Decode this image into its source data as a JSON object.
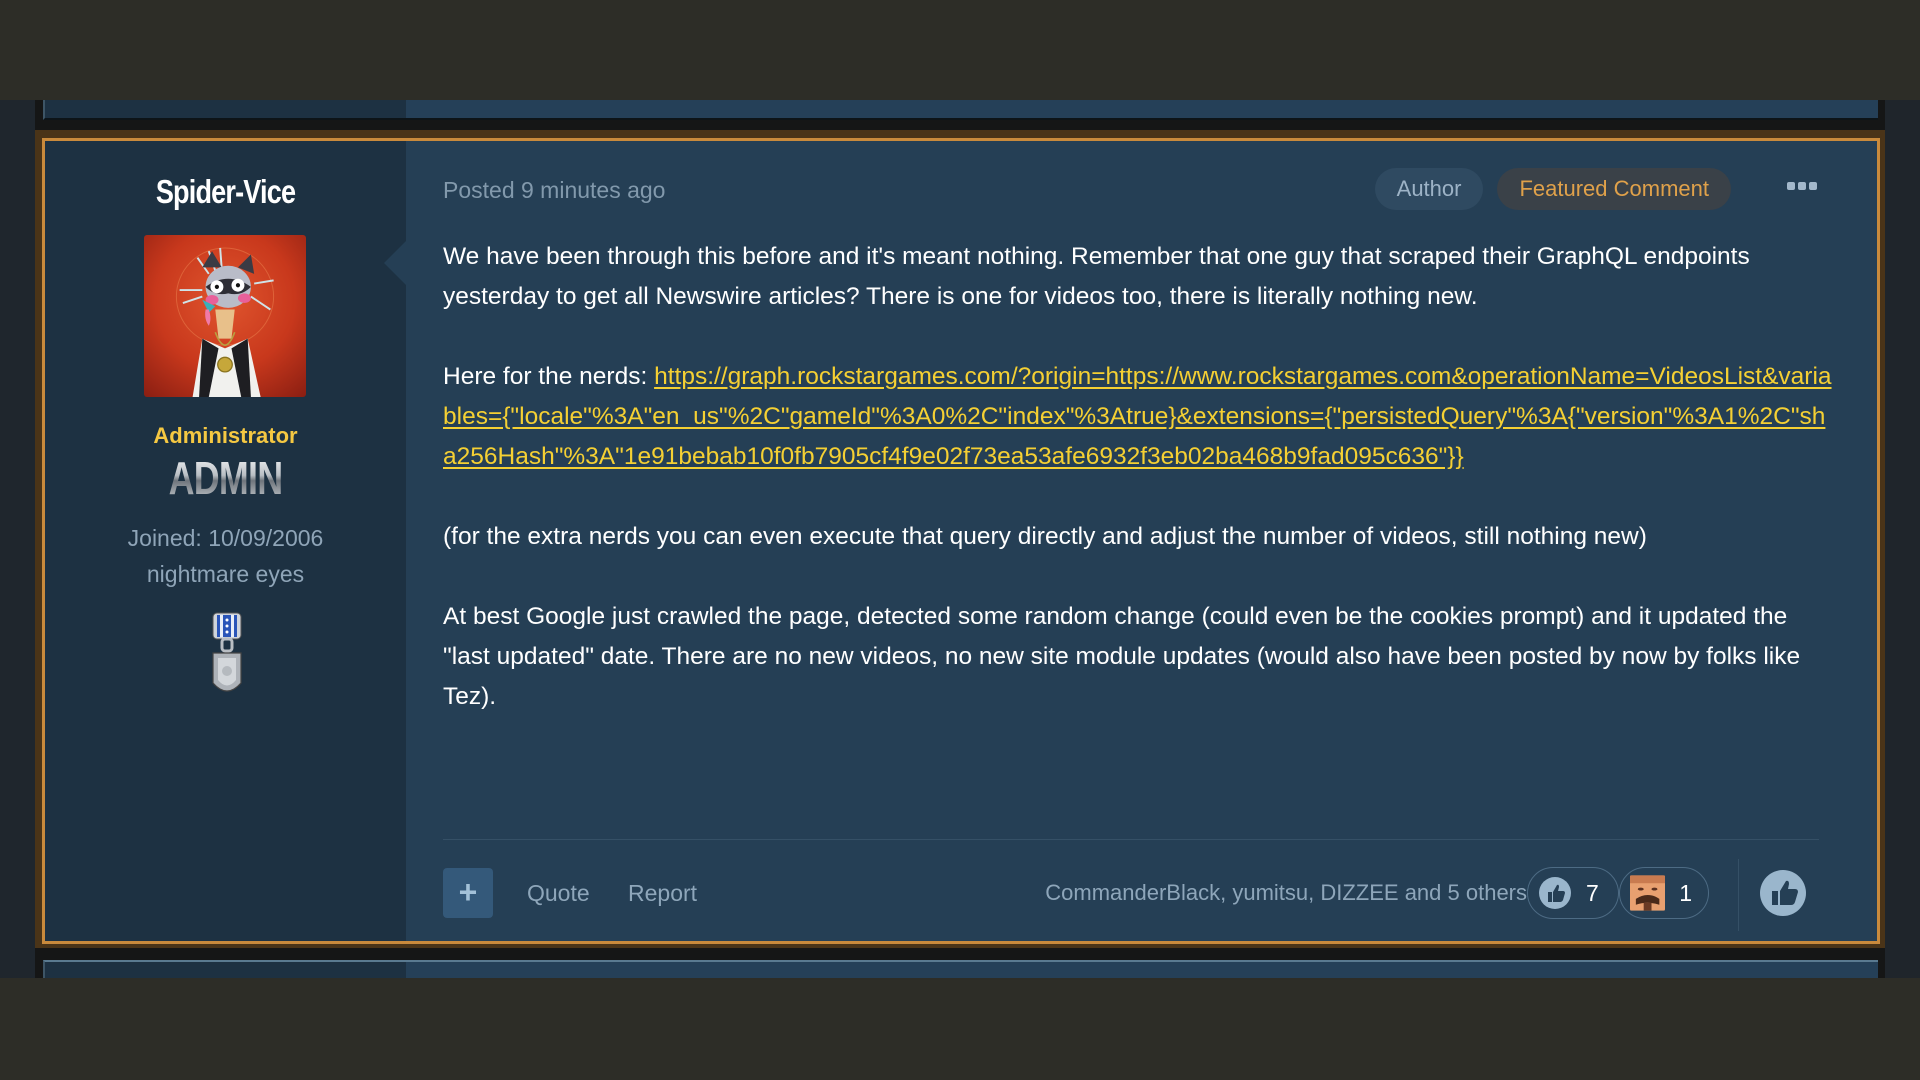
{
  "colors": {
    "featured_border": "#c98a3c",
    "link": "#f5d033",
    "role_title": "#f5c842",
    "featured_badge_text": "#e0a14a"
  },
  "author": {
    "name": "Spider-Vice",
    "avatar_icon": "raccoon-avatar",
    "role_title": "Administrator",
    "role_badge": "ADMIN",
    "joined": "Joined: 10/09/2006",
    "custom_title": "nightmare eyes",
    "award_icon": "medal-icon"
  },
  "post": {
    "meta": "Posted 9 minutes ago",
    "badges": {
      "author": "Author",
      "featured": "Featured Comment"
    },
    "more_icon": "ellipsis-icon",
    "paragraphs": {
      "p1": "We have been through this before and it's meant nothing. Remember that one guy that scraped their GraphQL endpoints yesterday to get all Newswire articles? There is one for videos too, there is literally nothing new.",
      "p2_prefix": "Here for the nerds: ",
      "p2_link": "https://graph.rockstargames.com/?origin=https://www.rockstargames.com&operationName=VideosList&variables={\"locale\"%3A\"en_us\"%2C\"gameId\"%3A0%2C\"index\"%3Atrue}&extensions={\"persistedQuery\"%3A{\"version\"%3A1%2C\"sha256Hash\"%3A\"1e91bebab10f0fb7905cf4f9e02f73ea53afe6932f3eb02ba468b9fad095c636\"}}",
      "p3": "(for the extra nerds you can even execute that query directly and adjust the number of videos, still nothing new)",
      "p4": "At best Google just crawled the page, detected some random change (could even be the cookies prompt) and it updated the \"last updated\" date. There are no new videos, no new site module updates (would also have been posted by now by folks like Tez)."
    }
  },
  "footer": {
    "plus_label": "+",
    "quote_label": "Quote",
    "report_label": "Report",
    "reactors": "CommanderBlack, yumitsu, DIZZEE and 5 others",
    "reactions": [
      {
        "icon": "thumbs-up-icon",
        "count": "7"
      },
      {
        "icon": "emote-face-icon",
        "count": "1"
      }
    ],
    "react_button_icon": "thumbs-up-icon"
  }
}
